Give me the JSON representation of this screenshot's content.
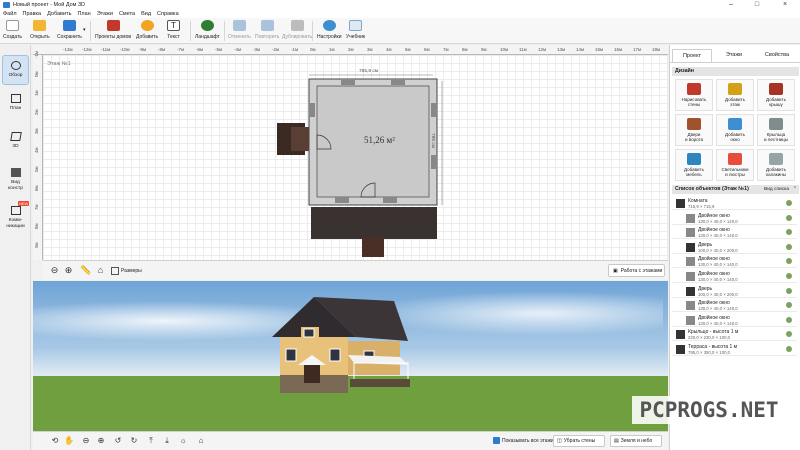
{
  "window": {
    "title": "Новый проект - Мой Дом 3D"
  },
  "menu": [
    "Файл",
    "Правка",
    "Добавить",
    "План",
    "Этажи",
    "Смета",
    "Вид",
    "Справка"
  ],
  "toolbar": {
    "create": "Создать",
    "open": "Открыть",
    "save": "Сохранить",
    "home_projects": "Проекты домов",
    "add": "Добавить",
    "text": "Текст",
    "landscape": "Ландшафт",
    "undo": "Отменить",
    "redo": "Повторить",
    "duplicate": "Дублировать",
    "settings": "Настройки",
    "tutorial": "Учебник"
  },
  "sidebar": [
    {
      "label": "Обзор",
      "active": true
    },
    {
      "label": "План"
    },
    {
      "label": "3D"
    },
    {
      "label": "Вид\nконстр"
    },
    {
      "label": "Комм-\nникации",
      "badge": "NEW"
    }
  ],
  "ruler": {
    "top": [
      "-13м",
      "-12м",
      "-11м",
      "-10м",
      "-9м",
      "-8м",
      "-7м",
      "-6м",
      "-5м",
      "-4м",
      "-3м",
      "-2м",
      "-1м",
      "0м",
      "1м",
      "2м",
      "3м",
      "4м",
      "5м",
      "6м",
      "7м",
      "8м",
      "9м",
      "10м",
      "11м",
      "12м",
      "13м",
      "14м",
      "15м",
      "16м",
      "17м",
      "18м",
      "19м"
    ],
    "left": [
      "-1м",
      "0м",
      "1м",
      "2м",
      "3м",
      "4м",
      "5м",
      "6м",
      "7м",
      "8м",
      "9м"
    ]
  },
  "plan": {
    "floor_label": "Этаж №1",
    "room_area": "51,26 м²",
    "dim_top": "795,9 см",
    "dim_right": "795 см"
  },
  "planbar": {
    "sizes": "Размеры",
    "floors": "Работа с этажами"
  },
  "view3d_bar": {
    "show_all_floors": "Показывать все этажи",
    "remove_walls": "Убрать стены",
    "ground_sky": "Земля и небо"
  },
  "rightpanel": {
    "tabs": [
      "Проект",
      "Этажи",
      "Свойства"
    ],
    "design_head": "Дизайн",
    "design_buttons": [
      {
        "label": "Нарисовать\nстены",
        "color": "#c0392b"
      },
      {
        "label": "Добавить\nэтаж",
        "color": "#d4a017"
      },
      {
        "label": "Добавить\nкрышу",
        "color": "#a93226"
      },
      {
        "label": "Двери\nи ворота",
        "color": "#a0522d"
      },
      {
        "label": "Добавить\nокно",
        "color": "#3d8fd1"
      },
      {
        "label": "Крыльца\nи лестницы",
        "color": "#7f8c8d"
      },
      {
        "label": "Добавить\nмебель",
        "color": "#2e86c1"
      },
      {
        "label": "Светильники\nи люстры",
        "color": "#e74c3c"
      },
      {
        "label": "Добавить\nкалакины",
        "color": "#95a5a6"
      }
    ],
    "objects_head": "Список объектов (Этаж №1)",
    "view_list": "Вид списка",
    "objects": [
      {
        "name": "Комната",
        "dims": "715,9 × 715,9",
        "child": false,
        "icon": "#333333"
      },
      {
        "name": "Двойное окно",
        "dims": "130,0 × 40,0 × 140,0",
        "child": true,
        "icon": "#888888"
      },
      {
        "name": "Двойное окно",
        "dims": "130,0 × 40,0 × 140,0",
        "child": true,
        "icon": "#888888"
      },
      {
        "name": "Дверь",
        "dims": "100,0 × 40,0 × 200,0",
        "child": true,
        "icon": "#333333"
      },
      {
        "name": "Двойное окно",
        "dims": "130,0 × 40,0 × 140,0",
        "child": true,
        "icon": "#888888"
      },
      {
        "name": "Двойное окно",
        "dims": "130,0 × 40,0 × 140,0",
        "child": true,
        "icon": "#888888"
      },
      {
        "name": "Дверь",
        "dims": "100,0 × 40,0 × 200,0",
        "child": true,
        "icon": "#333333"
      },
      {
        "name": "Двойное окно",
        "dims": "130,0 × 40,0 × 140,0",
        "child": true,
        "icon": "#888888"
      },
      {
        "name": "Двойное окно",
        "dims": "130,0 × 40,0 × 140,0",
        "child": true,
        "icon": "#888888"
      },
      {
        "name": "Крыльцо - высота 1 м",
        "dims": "220,0 × 230,0 × 100,0",
        "child": false,
        "icon": "#333333"
      },
      {
        "name": "Терраса - высота 1 м",
        "dims": "795,0 × 350,0 × 100,0",
        "child": false,
        "icon": "#333333"
      }
    ]
  },
  "watermark": "PCPROGS.NET",
  "colors": {
    "accent": "#2f7bd2",
    "grass": "#6f9f3f",
    "sky": "#8fb9e0",
    "brown_deck": "#3a3230"
  }
}
